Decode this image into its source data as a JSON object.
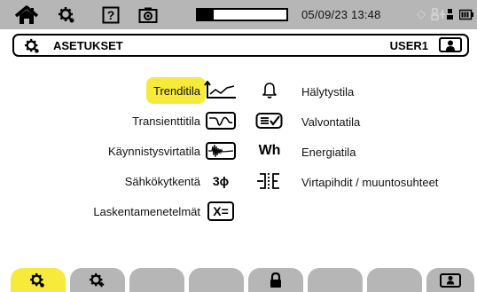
{
  "status_bar": {
    "datetime": "05/09/23 13:48",
    "busy_fraction": 0.18,
    "icons": [
      "home-icon",
      "settings-icon",
      "help-icon",
      "camera-icon",
      "sync-icon",
      "network-icon",
      "battery-icon"
    ]
  },
  "header": {
    "title": "ASETUKSET",
    "user": "USER1"
  },
  "menu": {
    "left": [
      {
        "label": "Trenditila",
        "icon": "trend-mode-icon"
      },
      {
        "label": "Transienttitila",
        "icon": "transient-mode-icon"
      },
      {
        "label": "Käynnistysvirtatila",
        "icon": "inrush-mode-icon"
      },
      {
        "label": "Sähkökytkentä",
        "icon": "three-phase-icon",
        "icon_text": "3ϕ"
      },
      {
        "label": "Laskentamenetelmät",
        "icon": "calculation-icon",
        "icon_text": "X="
      }
    ],
    "right": [
      {
        "label": "Hälytystila",
        "icon": "alarm-bell-icon"
      },
      {
        "label": "Valvontatila",
        "icon": "monitoring-icon"
      },
      {
        "label": "Energiatila",
        "icon": "energy-icon",
        "icon_text": "Wh"
      },
      {
        "label": "Virtapihdit / muuntosuhteet",
        "icon": "clamp-ratio-icon"
      }
    ]
  },
  "tabs": [
    {
      "name": "settings-tab",
      "icon": "gear-icon",
      "active": true
    },
    {
      "name": "advanced-settings-tab",
      "icon": "gear-plus-icon",
      "active": false
    },
    {
      "name": "empty-tab-3",
      "active": false
    },
    {
      "name": "empty-tab-4",
      "active": false
    },
    {
      "name": "lock-tab",
      "icon": "lock-icon",
      "active": false
    },
    {
      "name": "empty-tab-6",
      "active": false
    },
    {
      "name": "empty-tab-7",
      "active": false
    },
    {
      "name": "user-tab",
      "icon": "user-icon",
      "active": false
    }
  ],
  "colors": {
    "bar_grey": "#b6b6b6",
    "highlight_yellow": "#f7ea3a"
  }
}
